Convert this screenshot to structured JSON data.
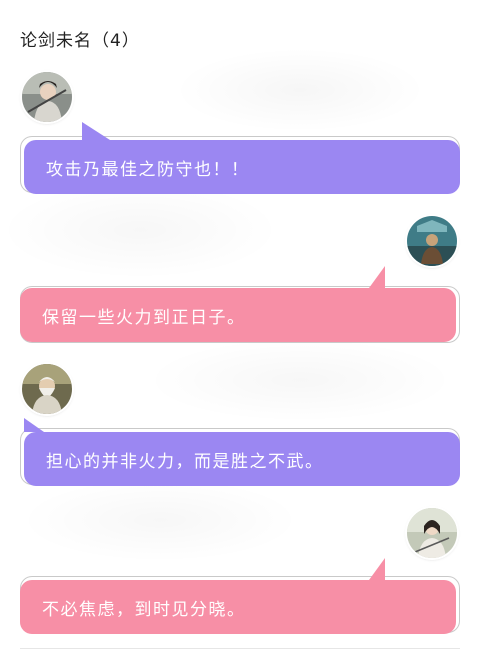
{
  "chat": {
    "title": "论剑未名（4）"
  },
  "messages": [
    {
      "side": "left",
      "color": "purple",
      "text": "攻击乃最佳之防守也！！",
      "avatar": "swordsman-avatar"
    },
    {
      "side": "right",
      "color": "pink",
      "text": "保留一些火力到正日子。",
      "avatar": "warrior-statue-avatar"
    },
    {
      "side": "left",
      "color": "purple",
      "text": "担心的并非火力，而是胜之不武。",
      "avatar": "elder-sage-avatar"
    },
    {
      "side": "right",
      "color": "pink",
      "text": "不必焦虑，到时见分晓。",
      "avatar": "swordswoman-avatar"
    }
  ],
  "colors": {
    "purple_bubble": "#9b87f2",
    "pink_bubble": "#f78fa6",
    "outline": "#c9c9c9"
  }
}
